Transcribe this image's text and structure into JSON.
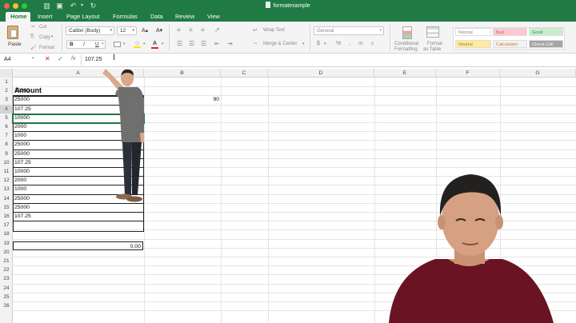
{
  "window": {
    "title": "formatexample"
  },
  "tabs": [
    {
      "label": "Home",
      "active": true
    },
    {
      "label": "Insert"
    },
    {
      "label": "Page Layout"
    },
    {
      "label": "Formulas"
    },
    {
      "label": "Data"
    },
    {
      "label": "Review"
    },
    {
      "label": "View"
    }
  ],
  "ribbon": {
    "paste_label": "Paste",
    "cut_label": "Cut",
    "copy_label": "Copy",
    "format_label": "Format",
    "font_name": "Calibri (Body)",
    "font_size": "12",
    "bold": "B",
    "italic": "I",
    "underline": "U",
    "wrap_text_label": "Wrap Text",
    "merge_center_label": "Merge & Center",
    "number_format": "General",
    "conditional_formatting_label_1": "Conditional",
    "conditional_formatting_label_2": "Formatting",
    "format_as_table_label_1": "Format",
    "format_as_table_label_2": "as Table",
    "styles": {
      "normal": "Normal",
      "bad": "Bad",
      "good": "Good",
      "neutral": "Neutral",
      "calculation": "Calculation",
      "check_cell": "Check Cell"
    }
  },
  "formula_bar": {
    "name_box": "A4",
    "fx": "fx",
    "content": "107.25"
  },
  "columns": [
    "A",
    "B",
    "C",
    "D",
    "E",
    "F",
    "G"
  ],
  "rows": [
    "1",
    "2",
    "3",
    "4",
    "5",
    "6",
    "7",
    "8",
    "9",
    "10",
    "11",
    "12",
    "13",
    "14",
    "15",
    "16",
    "17",
    "18",
    "19",
    "20",
    "21",
    "22",
    "23",
    "24",
    "25",
    "26"
  ],
  "cells": {
    "a1": "Amount",
    "a_values": [
      "25000",
      "25000",
      "107.25",
      "10000",
      "2000",
      "1000",
      "25000",
      "25000",
      "107.25",
      "10000",
      "2000",
      "1000",
      "25000",
      "25000",
      "107.25"
    ],
    "b2": "90",
    "a18": "0.00"
  },
  "colors": {
    "excel_green": "#1f7a44",
    "selected_row_header": "#d3d3d3",
    "style_bad": "#ffc7ce",
    "style_good": "#c6efce",
    "style_neutral": "#ffeb9c"
  }
}
